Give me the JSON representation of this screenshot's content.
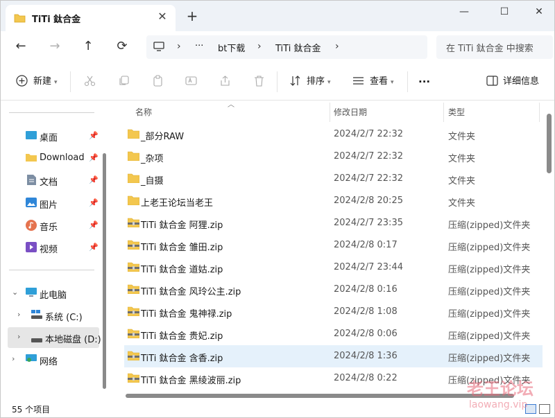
{
  "window": {
    "tab_title": "TiTi 鈦合金",
    "tab_close": "✕",
    "new_tab": "+",
    "minimize": "—",
    "maximize": "☐",
    "close": "✕"
  },
  "nav": {
    "back": "←",
    "forward": "→",
    "up": "↑",
    "refresh": "⟳",
    "breadcrumb_more": "···",
    "breadcrumb": [
      "bt下载",
      "TiTi 鈦合金"
    ],
    "separator": "›",
    "search_placeholder": "在 TiTi 鈦合金 中搜索"
  },
  "toolbar": {
    "new": "新建",
    "sort": "排序",
    "view": "查看",
    "more": "···",
    "details": "详细信息"
  },
  "sidebar": {
    "pinned": [
      {
        "label": "桌面",
        "icon": "desktop-icon"
      },
      {
        "label": "Download",
        "icon": "folder-icon"
      },
      {
        "label": "文档",
        "icon": "document-icon"
      },
      {
        "label": "图片",
        "icon": "picture-icon"
      },
      {
        "label": "音乐",
        "icon": "music-icon"
      },
      {
        "label": "视频",
        "icon": "video-icon"
      }
    ],
    "pin_glyph": "📌",
    "this_pc": "此电脑",
    "drives": [
      {
        "label": "系统 (C:)"
      },
      {
        "label": "本地磁盘 (D:)"
      }
    ],
    "network": "网络"
  },
  "columns": {
    "name": "名称",
    "date": "修改日期",
    "type": "类型"
  },
  "files": [
    {
      "name": "_部分RAW",
      "date": "2024/2/7 22:32",
      "type": "文件夹",
      "kind": "folder"
    },
    {
      "name": "_杂项",
      "date": "2024/2/7 22:32",
      "type": "文件夹",
      "kind": "folder"
    },
    {
      "name": "_自摄",
      "date": "2024/2/7 22:32",
      "type": "文件夹",
      "kind": "folder"
    },
    {
      "name": "上老王论坛当老王",
      "date": "2024/2/8 20:25",
      "type": "文件夹",
      "kind": "folder"
    },
    {
      "name": "TiTi 鈦合金 阿狸.zip",
      "date": "2024/2/7 23:35",
      "type": "压缩(zipped)文件夹",
      "kind": "zip"
    },
    {
      "name": "TiTi 鈦合金 雏田.zip",
      "date": "2024/2/8 0:17",
      "type": "压缩(zipped)文件夹",
      "kind": "zip"
    },
    {
      "name": "TiTi 鈦合金 道姑.zip",
      "date": "2024/2/7 23:44",
      "type": "压缩(zipped)文件夹",
      "kind": "zip"
    },
    {
      "name": "TiTi 鈦合金 风玲公主.zip",
      "date": "2024/2/8 0:16",
      "type": "压缩(zipped)文件夹",
      "kind": "zip"
    },
    {
      "name": "TiTi 鈦合金 鬼神禄.zip",
      "date": "2024/2/8 1:08",
      "type": "压缩(zipped)文件夹",
      "kind": "zip"
    },
    {
      "name": "TiTi 鈦合金 贵妃.zip",
      "date": "2024/2/8 0:06",
      "type": "压缩(zipped)文件夹",
      "kind": "zip"
    },
    {
      "name": "TiTi 鈦合金 含香.zip",
      "date": "2024/2/8 1:36",
      "type": "压缩(zipped)文件夹",
      "kind": "zip",
      "selected": true
    },
    {
      "name": "TiTi 鈦合金 黑绫波丽.zip",
      "date": "2024/2/8 0:22",
      "type": "压缩(zipped)文件夹",
      "kind": "zip"
    }
  ],
  "status": {
    "count": "55 个项目"
  },
  "watermark": {
    "main": "老王论坛",
    "sub": "laowang.vip"
  },
  "colors": {
    "accent": "#3b7bd2",
    "folder": "#f3c74f",
    "selection": "#e5f1fb"
  }
}
